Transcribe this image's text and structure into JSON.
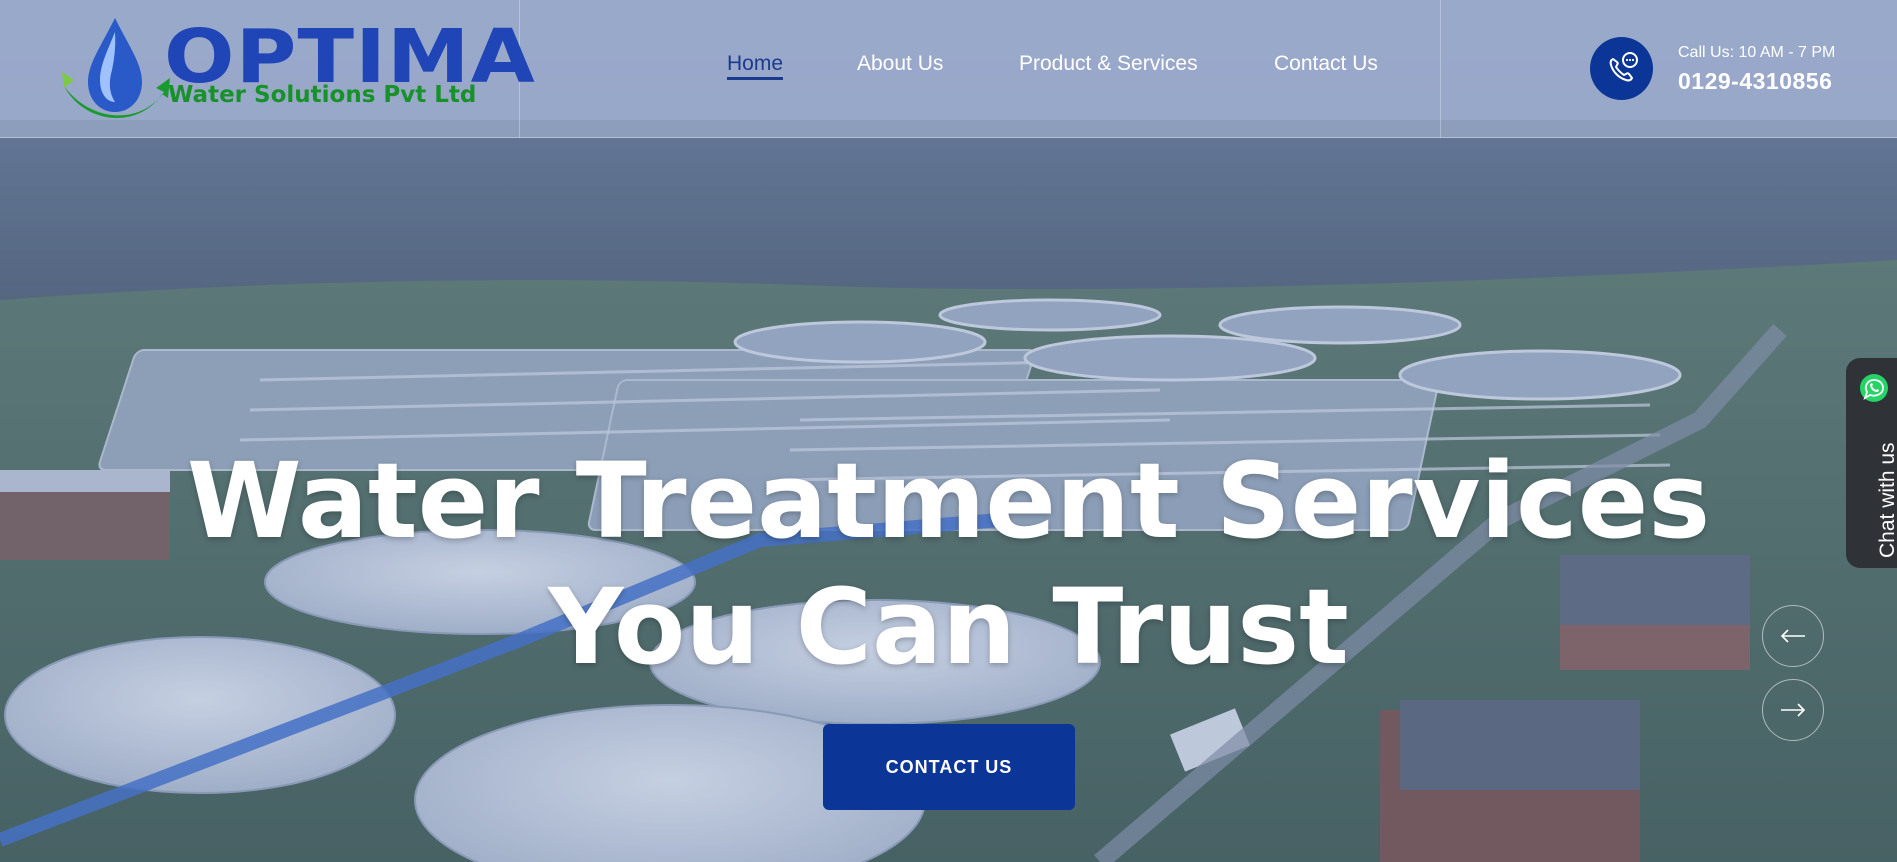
{
  "logo": {
    "title": "OPTIMA",
    "subtitle": "Water Solutions Pvt Ltd",
    "drop_icon": "water-drop-icon",
    "colors": {
      "title": "#1f45b6",
      "subtitle": "#18912a"
    }
  },
  "nav": {
    "items": [
      {
        "label": "Home",
        "active": true
      },
      {
        "label": "About Us",
        "active": false
      },
      {
        "label": "Product & Services",
        "active": false
      },
      {
        "label": "Contact Us",
        "active": false
      }
    ]
  },
  "contact": {
    "hours": "Call Us: 10 AM - 7 PM",
    "phone": "0129-4310856",
    "icon": "phone-chat-icon"
  },
  "hero": {
    "title_line1": "Water Treatment Services",
    "title_line2": "You Can Trust",
    "cta_label": "CONTACT US",
    "background": "aerial-water-treatment-plant-image"
  },
  "slider": {
    "prev_icon": "arrow-left-icon",
    "next_icon": "arrow-right-icon"
  },
  "chat": {
    "label": "Chat with us",
    "icon": "whatsapp-icon"
  },
  "colors": {
    "brand_blue": "#0b3596",
    "nav_active": "#1c3a8c",
    "chat_tab": "#2f3337",
    "whatsapp_green": "#25d366"
  }
}
